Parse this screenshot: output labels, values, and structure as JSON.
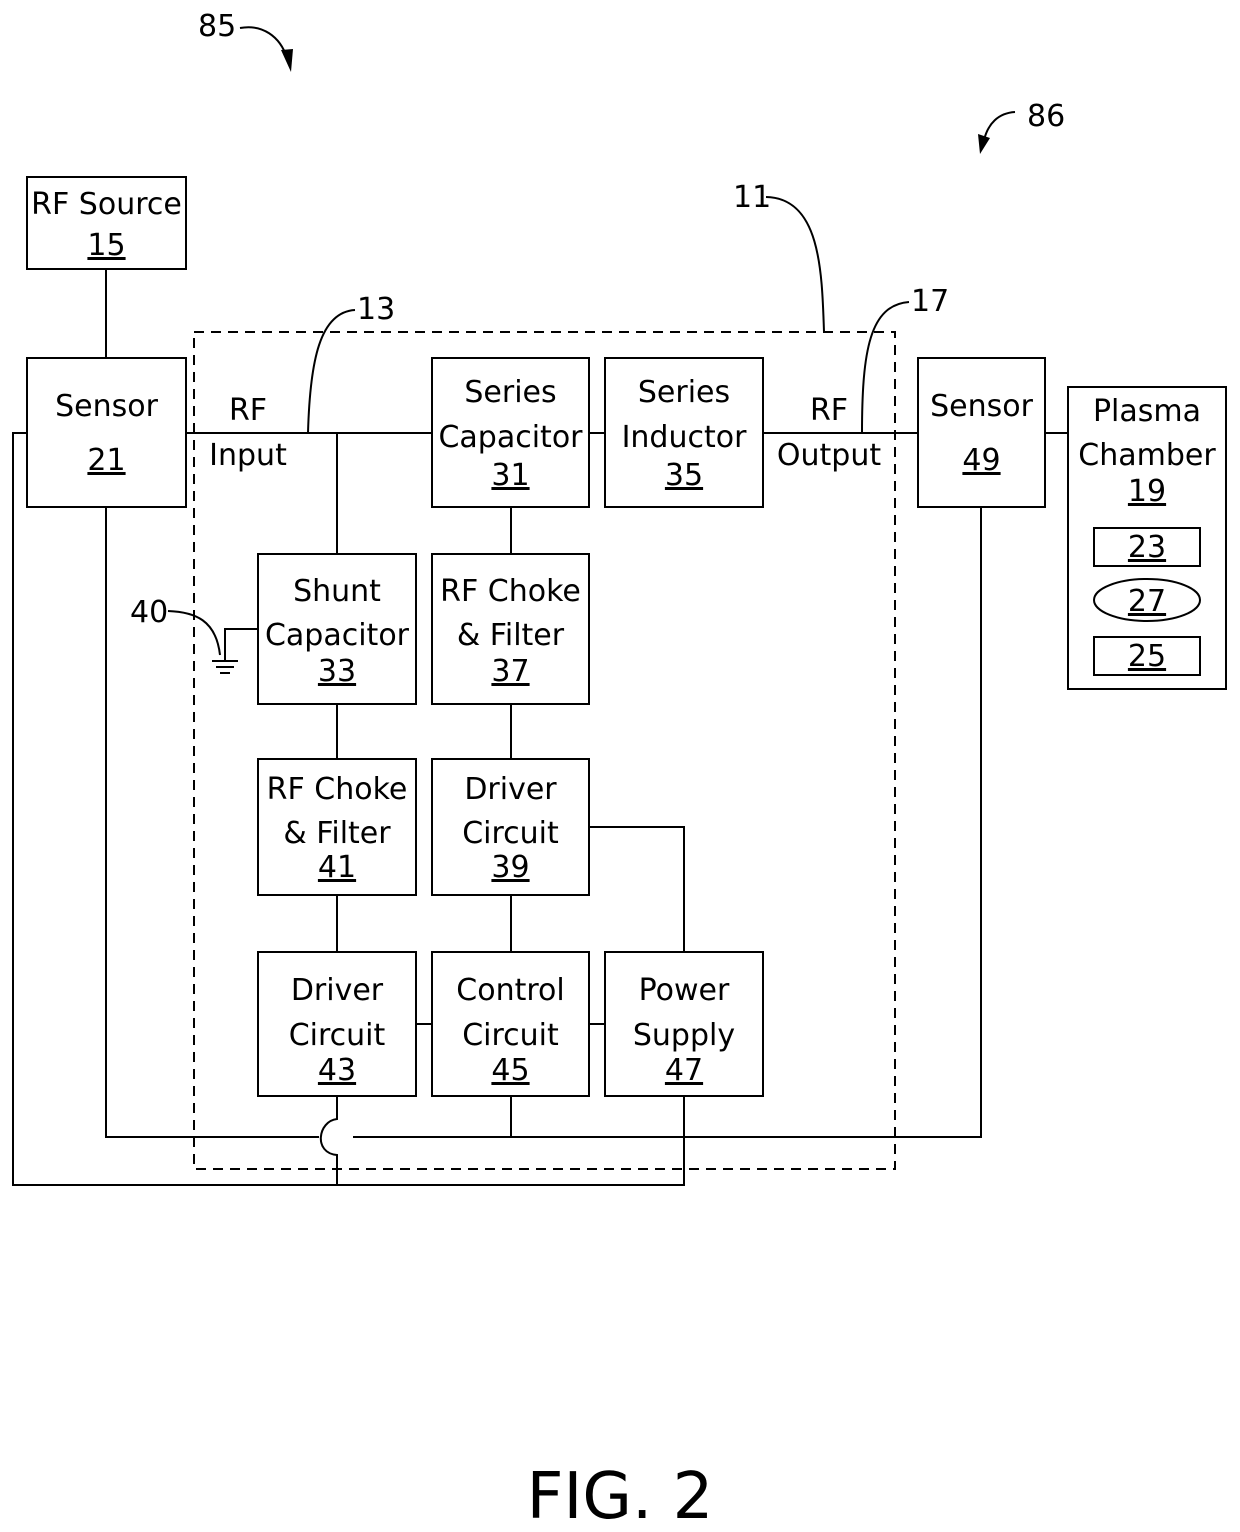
{
  "figure": {
    "caption": "FIG. 2",
    "system_refs": [
      "85",
      "86"
    ],
    "matching_network": {
      "ref": "11"
    },
    "rf_input": {
      "line1": "RF",
      "line2": "Input",
      "ref": "13"
    },
    "rf_output": {
      "line1": "RF",
      "line2": "Output",
      "ref": "17"
    },
    "ground": {
      "ref": "40"
    }
  },
  "blocks": {
    "rf_source": {
      "lines": [
        "RF Source"
      ],
      "ref": "15"
    },
    "sensor_in": {
      "lines": [
        "Sensor"
      ],
      "ref": "21"
    },
    "series_cap": {
      "lines": [
        "Series",
        "Capacitor"
      ],
      "ref": "31"
    },
    "series_ind": {
      "lines": [
        "Series",
        "Inductor"
      ],
      "ref": "35"
    },
    "sensor_out": {
      "lines": [
        "Sensor"
      ],
      "ref": "49"
    },
    "plasma_chamber": {
      "lines": [
        "Plasma",
        "Chamber"
      ],
      "ref": "19",
      "parts": [
        "23",
        "27",
        "25"
      ]
    },
    "shunt_cap": {
      "lines": [
        "Shunt",
        "Capacitor"
      ],
      "ref": "33"
    },
    "choke_37": {
      "lines": [
        "RF Choke",
        "& Filter"
      ],
      "ref": "37"
    },
    "choke_41": {
      "lines": [
        "RF Choke",
        "& Filter"
      ],
      "ref": "41"
    },
    "driver_39": {
      "lines": [
        "Driver",
        "Circuit"
      ],
      "ref": "39"
    },
    "driver_43": {
      "lines": [
        "Driver",
        "Circuit"
      ],
      "ref": "43"
    },
    "control_45": {
      "lines": [
        "Control",
        "Circuit"
      ],
      "ref": "45"
    },
    "power_47": {
      "lines": [
        "Power",
        "Supply"
      ],
      "ref": "47"
    }
  }
}
